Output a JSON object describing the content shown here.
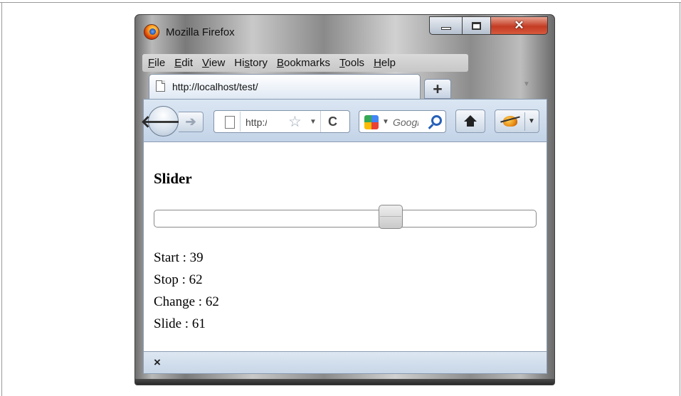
{
  "window": {
    "title": "Mozilla Firefox"
  },
  "menubar": {
    "items": [
      {
        "accel": "F",
        "rest": "ile"
      },
      {
        "accel": "E",
        "rest": "dit"
      },
      {
        "accel": "V",
        "rest": "iew"
      },
      {
        "pre": "Hi",
        "accel": "s",
        "rest": "tory"
      },
      {
        "accel": "B",
        "rest": "ookmarks"
      },
      {
        "accel": "T",
        "rest": "ools"
      },
      {
        "accel": "H",
        "rest": "elp"
      }
    ]
  },
  "tab": {
    "title": "http://localhost/test/",
    "new_tab_label": "+"
  },
  "navbar": {
    "url_value": "http://localhost/test/",
    "url_visible": "http:/.",
    "search_engine": "Google",
    "search_placeholder": "Google",
    "search_visible": "Goo"
  },
  "page": {
    "heading": "Slider",
    "slider_value": 62,
    "slider_min": 0,
    "slider_max": 100,
    "start_label": "Start : 39",
    "stop_label": "Stop : 62",
    "change_label": "Change : 62",
    "slide_label": "Slide : 61"
  },
  "statusbar": {
    "close_label": "×"
  },
  "icons": {
    "window": "firefox-logo-icon",
    "back": "back-arrow-icon",
    "forward": "forward-arrow-icon",
    "bookmark": "star-icon",
    "reload": "reload-icon",
    "search": "magnifier-icon",
    "home": "home-icon",
    "addon": "firebug-icon"
  }
}
